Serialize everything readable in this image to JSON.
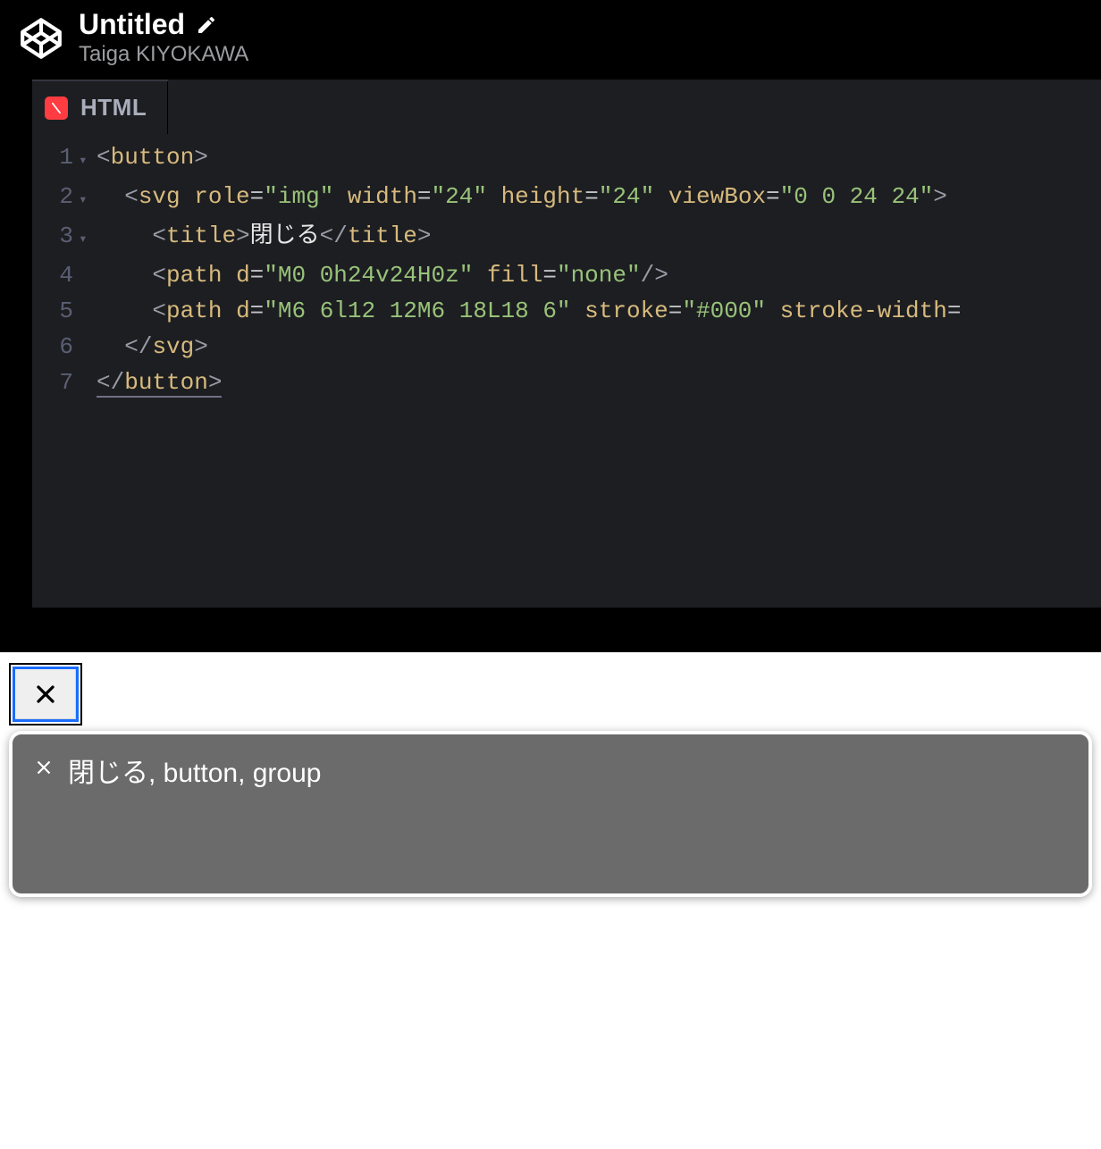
{
  "header": {
    "title": "Untitled",
    "author": "Taiga KIYOKAWA"
  },
  "tab": {
    "label": "HTML"
  },
  "code": {
    "lines": [
      {
        "n": "1",
        "fold": true,
        "tokens": [
          [
            "br",
            "<"
          ],
          [
            "t",
            "button"
          ],
          [
            "br",
            ">"
          ]
        ]
      },
      {
        "n": "2",
        "fold": true,
        "indent": 1,
        "tokens": [
          [
            "br",
            "<"
          ],
          [
            "t",
            "svg"
          ],
          [
            "sp",
            " "
          ],
          [
            "at",
            "role"
          ],
          [
            "eq",
            "="
          ],
          [
            "st",
            "\"img\""
          ],
          [
            "sp",
            " "
          ],
          [
            "at",
            "width"
          ],
          [
            "eq",
            "="
          ],
          [
            "st",
            "\"24\""
          ],
          [
            "sp",
            " "
          ],
          [
            "at",
            "height"
          ],
          [
            "eq",
            "="
          ],
          [
            "st",
            "\"24\""
          ],
          [
            "sp",
            " "
          ],
          [
            "at",
            "viewBox"
          ],
          [
            "eq",
            "="
          ],
          [
            "st",
            "\"0 0 24 24\""
          ],
          [
            "br",
            ">"
          ]
        ]
      },
      {
        "n": "3",
        "fold": true,
        "indent": 2,
        "tokens": [
          [
            "br",
            "<"
          ],
          [
            "t",
            "title"
          ],
          [
            "br",
            ">"
          ],
          [
            "tx",
            "閉じる"
          ],
          [
            "br",
            "</"
          ],
          [
            "t",
            "title"
          ],
          [
            "br",
            ">"
          ]
        ]
      },
      {
        "n": "4",
        "fold": false,
        "indent": 2,
        "tokens": [
          [
            "br",
            "<"
          ],
          [
            "t",
            "path"
          ],
          [
            "sp",
            " "
          ],
          [
            "at",
            "d"
          ],
          [
            "eq",
            "="
          ],
          [
            "st",
            "\"M0 0h24v24H0z\""
          ],
          [
            "sp",
            " "
          ],
          [
            "at",
            "fill"
          ],
          [
            "eq",
            "="
          ],
          [
            "st",
            "\"none\""
          ],
          [
            "br",
            "/>"
          ]
        ]
      },
      {
        "n": "5",
        "fold": false,
        "indent": 2,
        "tokens": [
          [
            "br",
            "<"
          ],
          [
            "t",
            "path"
          ],
          [
            "sp",
            " "
          ],
          [
            "at",
            "d"
          ],
          [
            "eq",
            "="
          ],
          [
            "st",
            "\"M6 6l12 12M6 18L18 6\""
          ],
          [
            "sp",
            " "
          ],
          [
            "at",
            "stroke"
          ],
          [
            "eq",
            "="
          ],
          [
            "st",
            "\"#000\""
          ],
          [
            "sp",
            " "
          ],
          [
            "at",
            "stroke-width"
          ],
          [
            "eq",
            "="
          ]
        ]
      },
      {
        "n": "6",
        "fold": false,
        "indent": 1,
        "tokens": [
          [
            "br",
            "</"
          ],
          [
            "t",
            "svg"
          ],
          [
            "br",
            ">"
          ]
        ]
      },
      {
        "n": "7",
        "fold": false,
        "indent": 0,
        "underline": true,
        "tokens": [
          [
            "br",
            "</"
          ],
          [
            "t",
            "button"
          ],
          [
            "br",
            ">"
          ]
        ]
      }
    ]
  },
  "tooltip": {
    "text": "閉じる, button, group"
  }
}
